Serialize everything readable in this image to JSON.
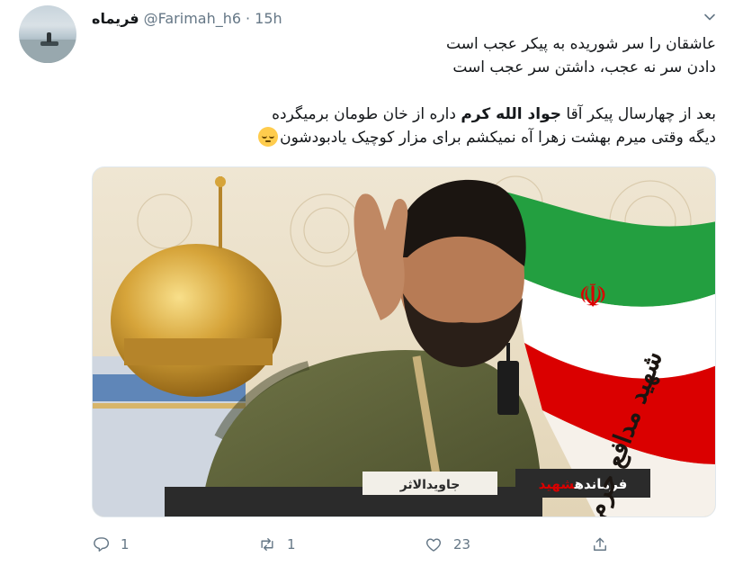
{
  "tweet": {
    "display_name": "فریماه",
    "handle": "@Farimah_h6",
    "separator": "·",
    "time": "15h",
    "text": {
      "line1": "عاشقان را سر شوریده به پیکر عجب است",
      "line2": "دادن سر نه عجب، داشتن سر عجب است",
      "line3_before": "بعد از چهارسال پیکر آقا",
      "line3_bold": "جواد الله کرم",
      "line3_after": "داره از خان طومان برمیگرده",
      "line4": "دیگه وقتی میرم بهشت زهرا آه نمیکشم برای مزار کوچیک یادبودشون"
    },
    "media": {
      "label_commander_prefix": "فرمانده",
      "label_commander_martyr": "شهید",
      "label_javid": "جاویدالاثر",
      "calligraphy": "شهید مدافع حرم",
      "flag_emblem": "☫"
    },
    "actions": {
      "reply_count": "1",
      "retweet_count": "1",
      "like_count": "23"
    }
  },
  "icons": {
    "reply": "reply-icon",
    "retweet": "retweet-icon",
    "like": "heart-icon",
    "share": "share-icon",
    "caret": "chevron-down-icon",
    "emoji": "pensive-face-emoji"
  },
  "colors": {
    "text": "#14171a",
    "muted": "#657786",
    "flag_green": "#239f40",
    "flag_red": "#da0000"
  }
}
